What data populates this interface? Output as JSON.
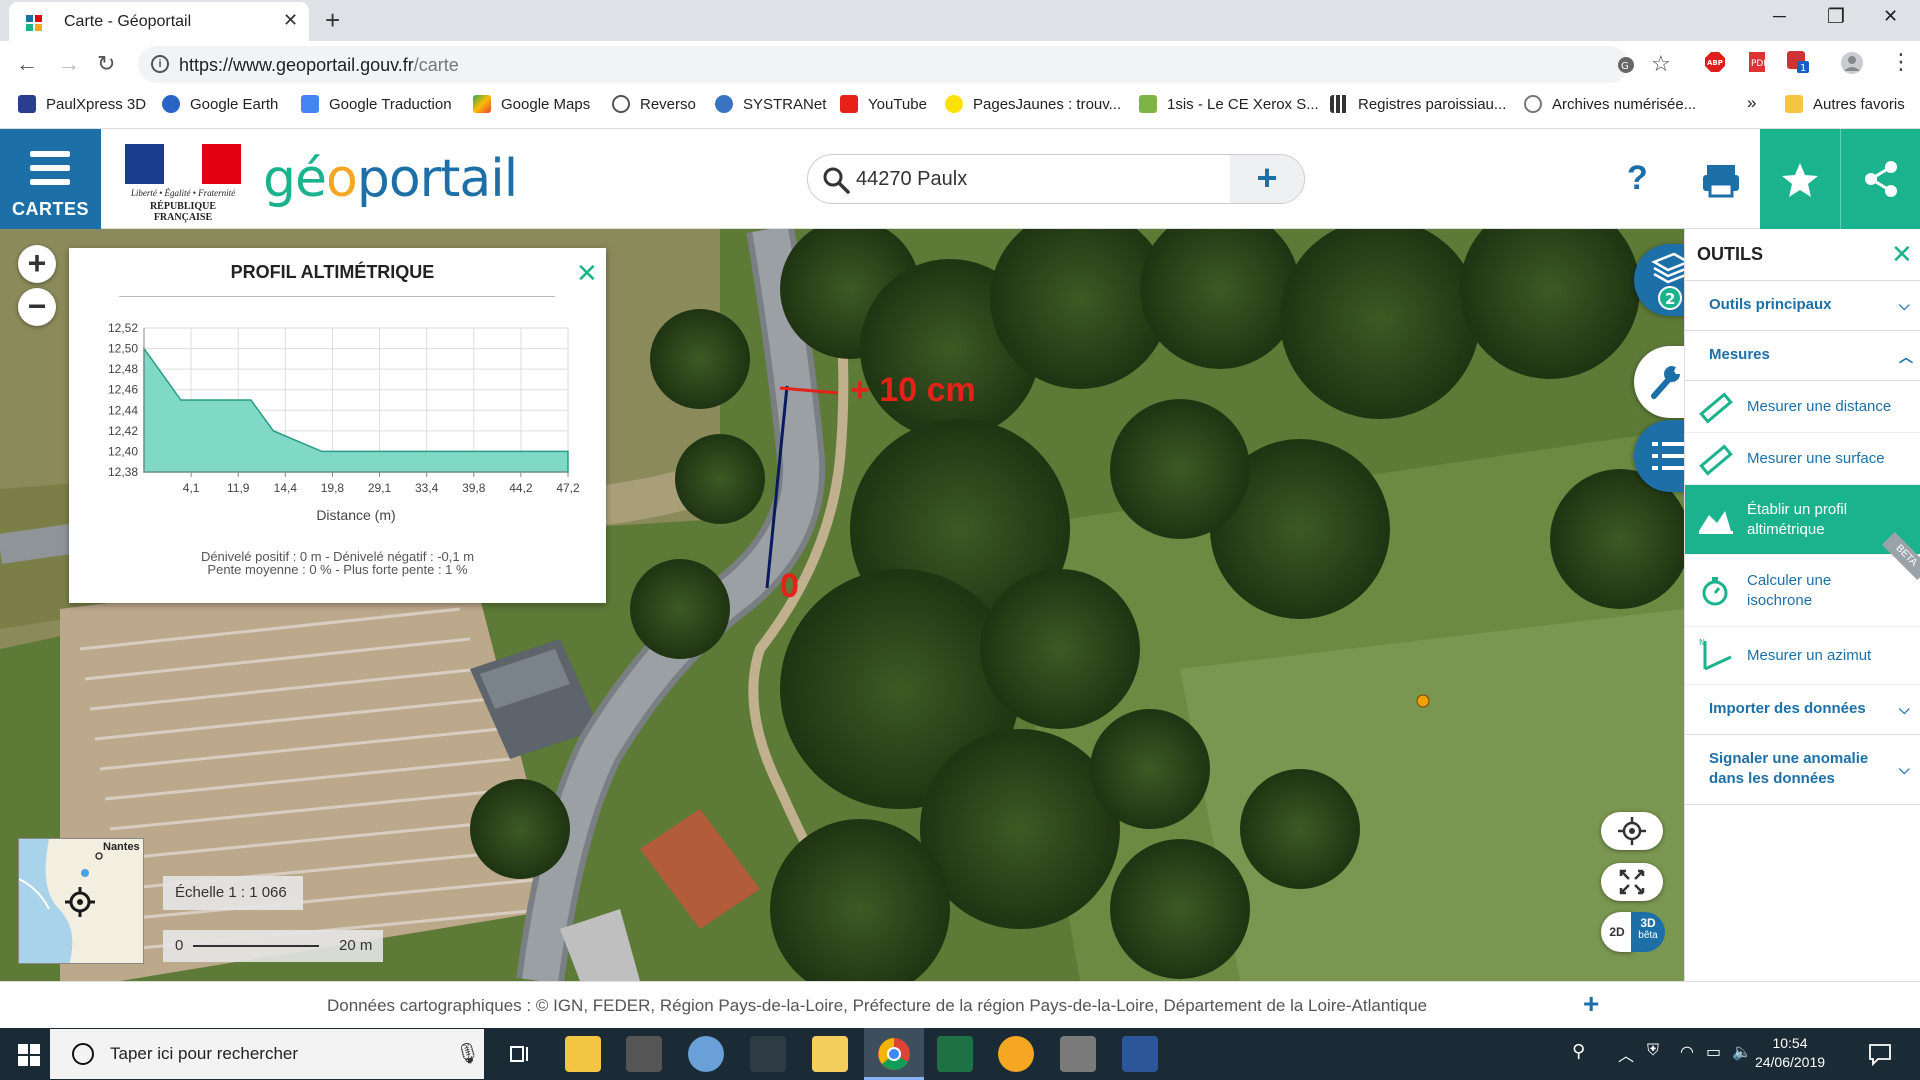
{
  "browser": {
    "tab_title": "Carte - Géoportail",
    "url_host": "https://www.geoportail.gouv.fr",
    "url_path": "/carte",
    "bookmarks": [
      "PaulXpress 3D",
      "Google Earth",
      "Google Traduction",
      "Google Maps",
      "Reverso",
      "SYSTRANet",
      "YouTube",
      "PagesJaunes : trouv...",
      "1sis - Le CE Xerox S...",
      "Registres paroissiau...",
      "Archives numérisée..."
    ],
    "other_bookmarks": "Autres favoris",
    "overflow": "»"
  },
  "header": {
    "menu_label": "CARTES",
    "rf_motto": "Liberté • Égalité • Fraternité",
    "rf_name": "RÉPUBLIQUE FRANÇAISE",
    "logo_ge": "gé",
    "logo_o": "o",
    "logo_portail": "portail",
    "search_value": "44270 Paulx",
    "help": "?"
  },
  "profile": {
    "title": "PROFIL ALTIMÉTRIQUE",
    "x_label": "Distance (m)",
    "stats_line1": "Dénivelé positif : 0 m - Dénivelé négatif : -0,1 m",
    "stats_line2": "Pente moyenne : 0 % - Plus forte pente : 1 %"
  },
  "chart_data": {
    "type": "area",
    "title": "PROFIL ALTIMÉTRIQUE",
    "xlabel": "Distance (m)",
    "ylabel": "",
    "x_ticks": [
      "4,1",
      "11,9",
      "14,4",
      "19,8",
      "29,1",
      "33,4",
      "39,8",
      "44,2",
      "47,2"
    ],
    "y_ticks": [
      "12,52",
      "12,50",
      "12,48",
      "12,46",
      "12,44",
      "12,42",
      "12,40",
      "12,38"
    ],
    "ylim": [
      12.38,
      12.52
    ],
    "x": [
      0,
      4.1,
      11.9,
      14.4,
      19.8,
      29.1,
      33.4,
      39.8,
      44.2,
      47.2
    ],
    "y": [
      12.5,
      12.45,
      12.45,
      12.42,
      12.4,
      12.4,
      12.4,
      12.4,
      12.4,
      12.4
    ],
    "color": "#7fd9c6"
  },
  "map_annotations": {
    "top_label": "+ 10 cm",
    "bottom_label": "0"
  },
  "tools": {
    "title": "OUTILS",
    "sections": {
      "main": "Outils principaux",
      "mesures": "Mesures",
      "import": "Importer des données",
      "report": "Signaler une anomalie dans les données"
    },
    "items": {
      "distance": "Mesurer une distance",
      "surface": "Mesurer une surface",
      "profile": "Établir un profil altimétrique",
      "isochrone": "Calculer une isochrone",
      "azimut": "Mesurer un azimut"
    },
    "beta": "BETA",
    "layers_count": "2"
  },
  "map_ui": {
    "minimap_label": "Nantes",
    "scale_text": "Échelle 1 : 1 066",
    "scale_start": "0",
    "scale_end": "20 m",
    "btn_2d": "2D",
    "btn_3d": "3D",
    "btn_beta": "bêta"
  },
  "attribution": "Données cartographiques : ©  IGN,  FEDER,  Région Pays-de-la-Loire,  Préfecture de la région Pays-de-la-Loire,  Département de la Loire-Atlantique",
  "taskbar": {
    "search_placeholder": "Taper ici pour rechercher",
    "time": "10:54",
    "date": "24/06/2019"
  },
  "colors": {
    "geoportail_blue": "#1d70a7",
    "geoportail_green": "#1ab38e",
    "annotation_red": "#e5211a",
    "profile_fill": "#7fd9c6"
  }
}
